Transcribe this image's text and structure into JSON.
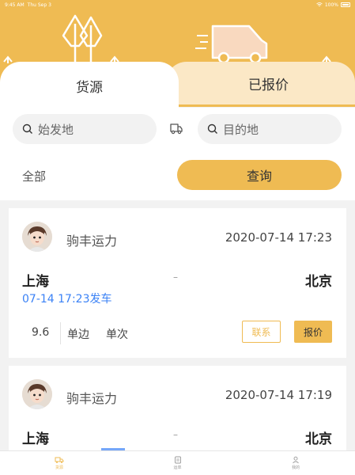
{
  "status_bar": {
    "time": "9:45 AM",
    "date": "Thu Sep 3",
    "battery": "100%"
  },
  "colors": {
    "accent": "#efbb53",
    "tab_inactive_bg": "#fbe8c6",
    "link_blue": "#3b82f6"
  },
  "tabs": [
    {
      "label": "货源",
      "active": true
    },
    {
      "label": "已报价",
      "active": false
    }
  ],
  "search": {
    "origin_placeholder": "始发地",
    "destination_placeholder": "目的地",
    "filter_label": "全部",
    "query_label": "查询"
  },
  "listings": [
    {
      "company": "驹丰运力",
      "posted_time": "2020-07-14 17:23",
      "from": "上海",
      "separator": "–",
      "to": "北京",
      "depart": "07-14 17:23发车",
      "length": "9.6",
      "trip_type": "单边",
      "frequency": "单次",
      "contact_label": "联系",
      "quote_label": "报价"
    },
    {
      "company": "驹丰运力",
      "posted_time": "2020-07-14 17:19",
      "from": "上海",
      "separator": "–",
      "to": "北京"
    }
  ],
  "tabbar": [
    {
      "label": "货源",
      "icon": "truck-icon",
      "active": true
    },
    {
      "label": "运单",
      "icon": "waybill-icon",
      "active": false
    },
    {
      "label": "我的",
      "icon": "user-icon",
      "active": false
    }
  ]
}
